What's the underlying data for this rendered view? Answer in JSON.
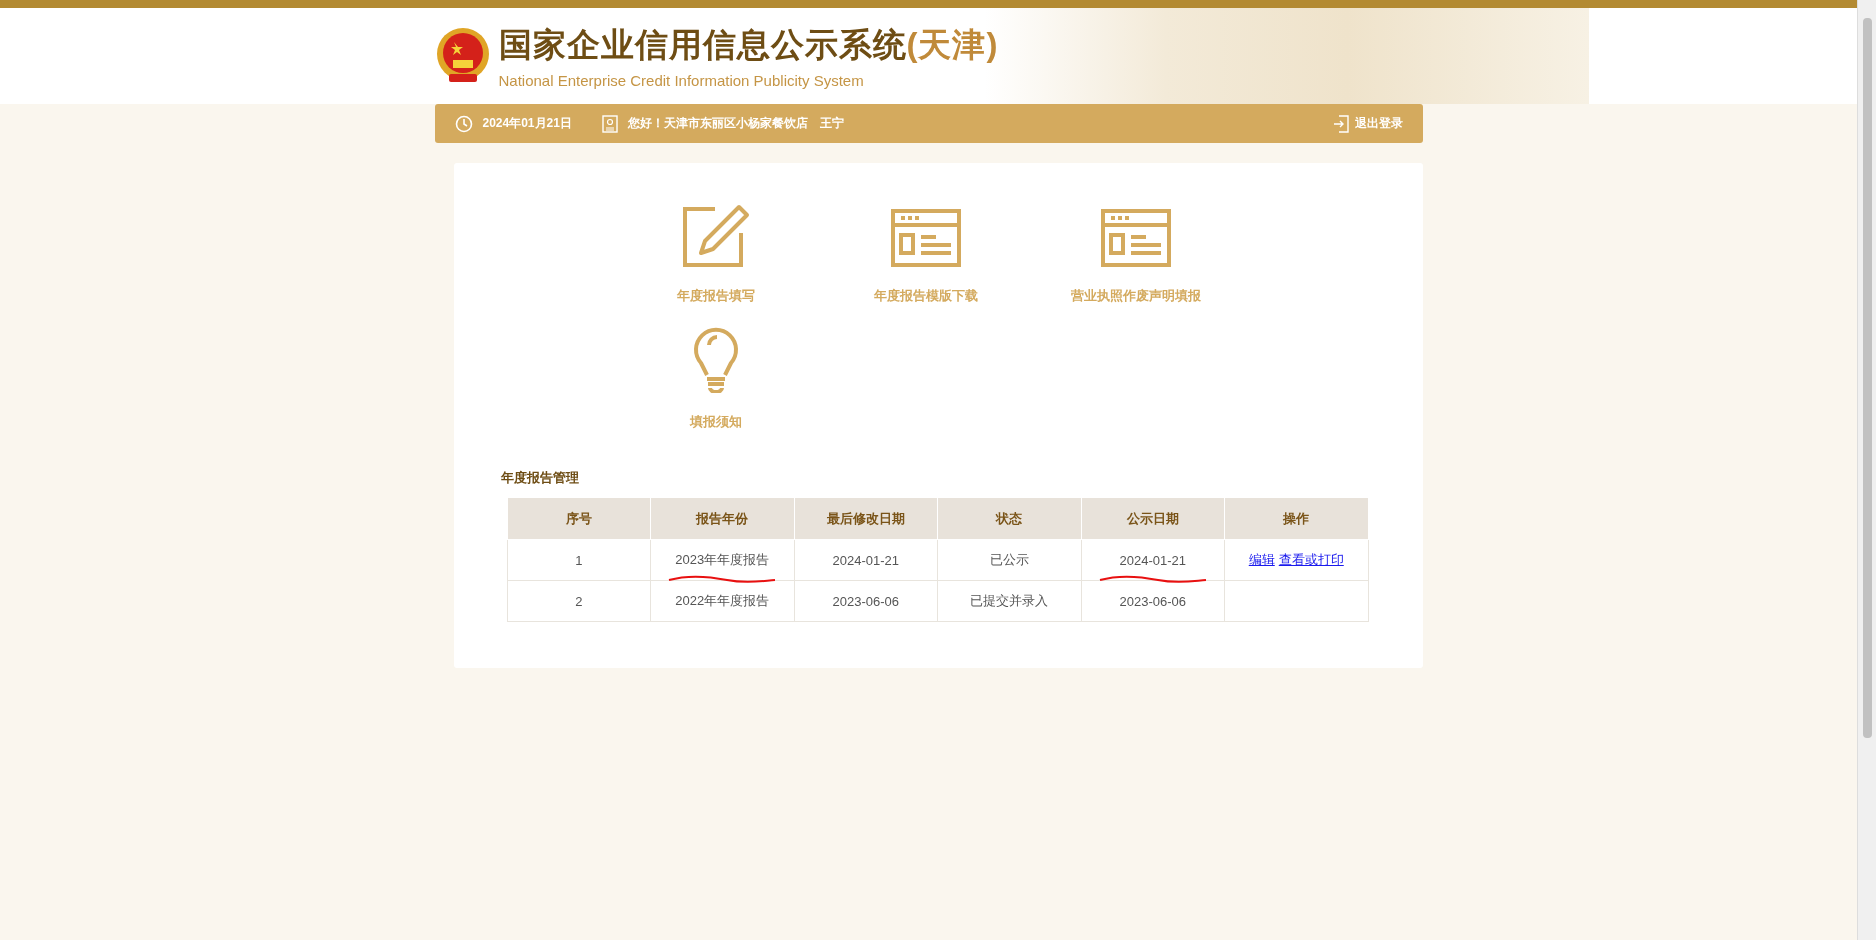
{
  "header": {
    "title": "国家企业信用信息公示系统",
    "region": "(天津)",
    "subtitle": "National Enterprise Credit Information Publicity System"
  },
  "nav": {
    "date": "2024年01月21日",
    "greeting": "您好！天津市东丽区小杨家餐饮店　王宁",
    "logout": "退出登录"
  },
  "tiles": [
    {
      "kind": "edit",
      "label": "年度报告填写"
    },
    {
      "kind": "form",
      "label": "年度报告模版下载"
    },
    {
      "kind": "form",
      "label": "营业执照作废声明填报"
    },
    {
      "kind": "bulb",
      "label": "填报须知"
    }
  ],
  "section_title": "年度报告管理",
  "table": {
    "columns": [
      "序号",
      "报告年份",
      "最后修改日期",
      "状态",
      "公示日期",
      "操作"
    ],
    "rows": [
      {
        "cells": [
          {
            "text": "1",
            "marked": false
          },
          {
            "text": "2023年年度报告",
            "marked": true
          },
          {
            "text": "2024-01-21",
            "marked": false
          },
          {
            "text": "已公示",
            "marked": false
          },
          {
            "text": "2024-01-21",
            "marked": true
          }
        ],
        "actions": [
          "编辑",
          "查看或打印"
        ]
      },
      {
        "cells": [
          {
            "text": "2",
            "marked": false
          },
          {
            "text": "2022年年度报告",
            "marked": false
          },
          {
            "text": "2023-06-06",
            "marked": false
          },
          {
            "text": "已提交并录入",
            "marked": false
          },
          {
            "text": "2023-06-06",
            "marked": false
          }
        ],
        "actions": []
      }
    ]
  }
}
